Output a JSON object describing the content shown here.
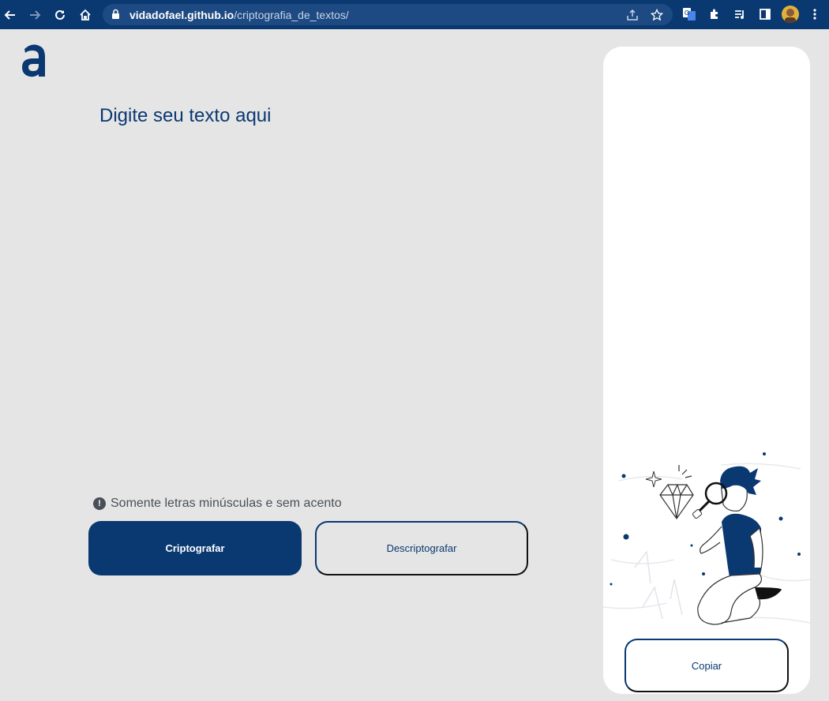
{
  "browser": {
    "url_host": "vidadofael.github.io",
    "url_path": "/criptografia_de_textos/"
  },
  "page": {
    "input_placeholder": "Digite seu texto aqui",
    "hint": "Somente letras minúsculas e sem acento",
    "hint_icon": "!",
    "encrypt_label": "Criptografar",
    "decrypt_label": "Descriptografar",
    "copy_label": "Copiar"
  },
  "colors": {
    "primary": "#0a3871",
    "background": "#e5e5e5",
    "hint": "#495057"
  },
  "icons": [
    "back-icon",
    "forward-icon",
    "reload-icon",
    "home-icon",
    "lock-icon",
    "share-icon",
    "star-icon",
    "translate-icon",
    "puzzle-icon",
    "media-icon",
    "sidepanel-icon",
    "menu-icon",
    "logo-icon",
    "exclamation-icon",
    "illustration-image"
  ]
}
